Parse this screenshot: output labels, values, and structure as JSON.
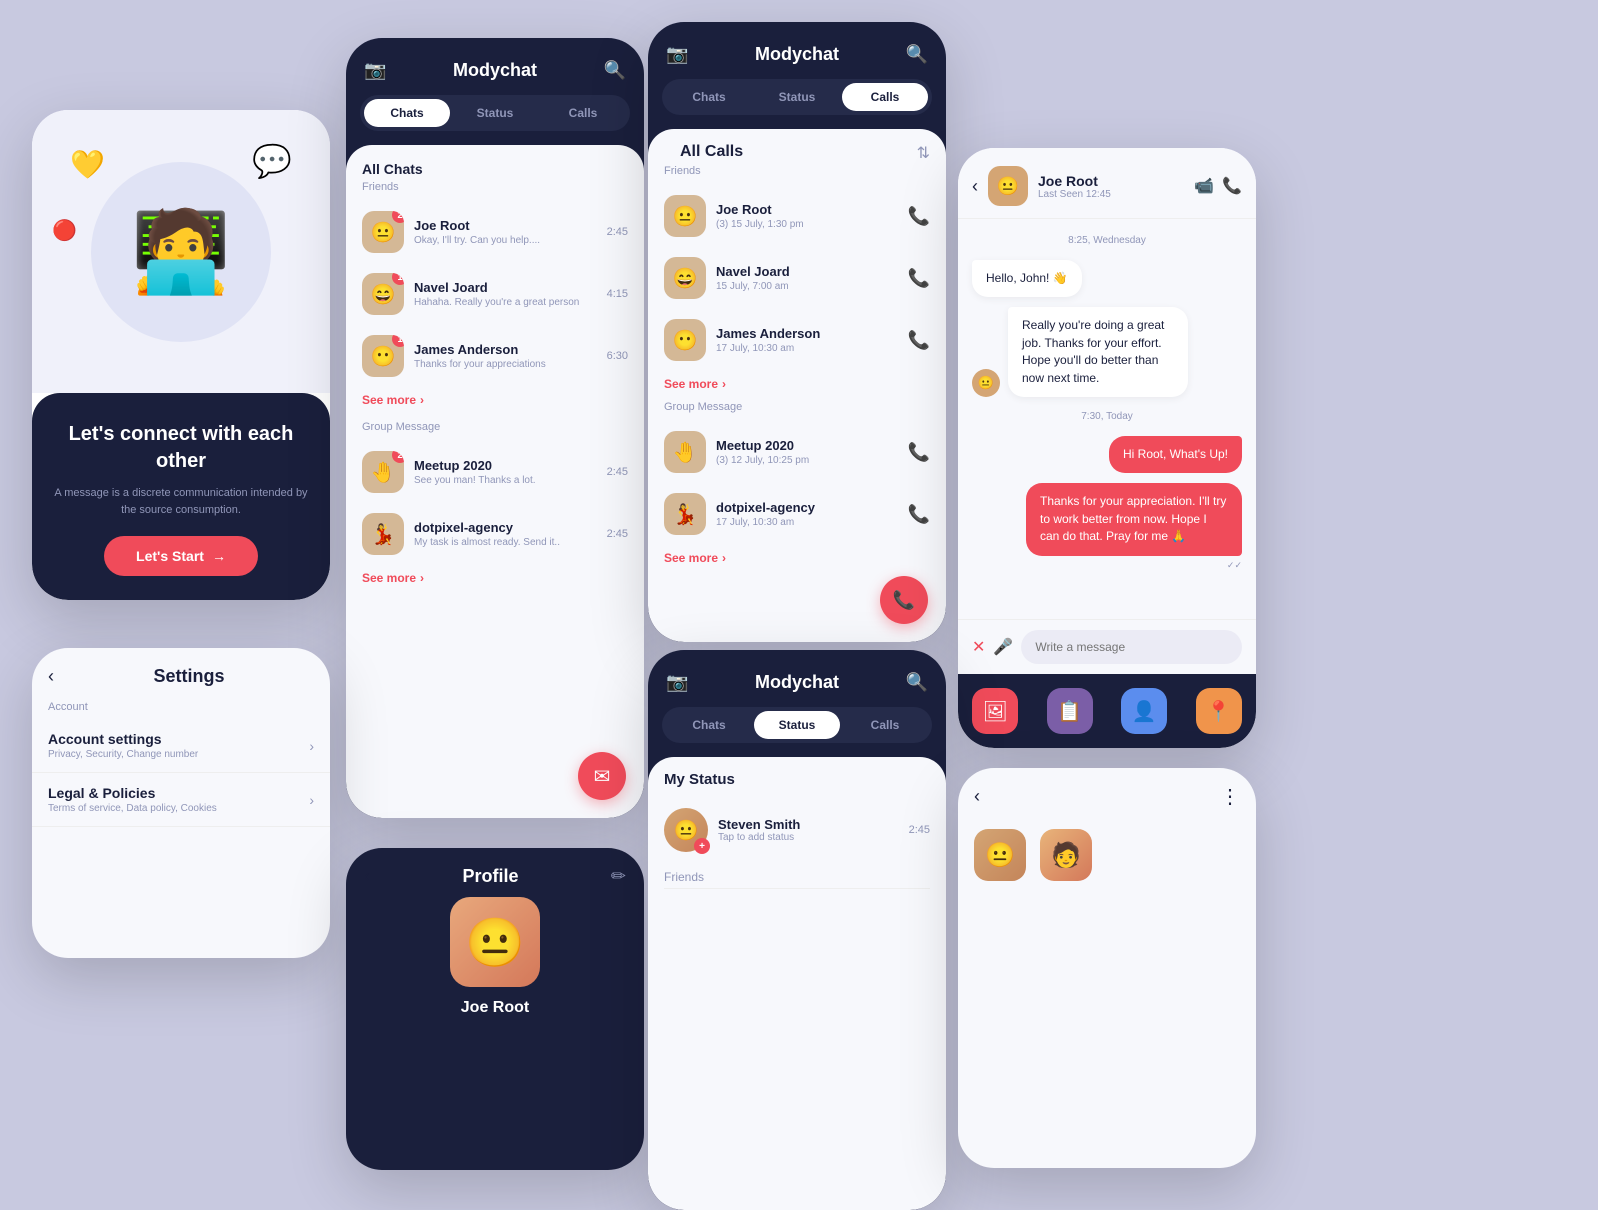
{
  "app": {
    "name": "Modychat"
  },
  "welcome": {
    "title": "Let's connect\nwith each other",
    "subtitle": "A message is a discrete communication intended by the source consumption.",
    "cta_label": "Let's Start",
    "cta_arrow": "→"
  },
  "tabs": {
    "chats": "Chats",
    "status": "Status",
    "calls": "Calls"
  },
  "chats_screen": {
    "section_friends": "All Chats",
    "sub_friends": "Friends",
    "sub_group": "Group Message",
    "see_more": "See more",
    "friends": [
      {
        "name": "Joe Root",
        "preview": "Okay, I'll try. Can you help....",
        "time": "2:45",
        "badge": "2",
        "face": "😐"
      },
      {
        "name": "Navel Joard",
        "preview": "Hahaha. Really you're a great person",
        "time": "4:15",
        "badge": "1",
        "face": "😄"
      },
      {
        "name": "James Anderson",
        "preview": "Thanks for your appreciations",
        "time": "6:30",
        "badge": "1",
        "face": "😶"
      }
    ],
    "groups": [
      {
        "name": "Meetup 2020",
        "preview": "See you man! Thanks a lot.",
        "time": "2:45",
        "badge": "2",
        "face": "🤚"
      },
      {
        "name": "dotpixel-agency",
        "preview": "My task is almost ready. Send it..",
        "time": "2:45",
        "face": "💃"
      }
    ]
  },
  "calls_screen": {
    "section_title": "All Calls",
    "sub_friends": "Friends",
    "sub_group": "Group Message",
    "see_more": "See more",
    "friends": [
      {
        "name": "Joe Root",
        "time": "(3) 15 July, 1:30 pm",
        "type": "incoming",
        "face": "😐"
      },
      {
        "name": "Navel Joard",
        "time": "15 July, 7:00 am",
        "type": "incoming",
        "face": "😄"
      },
      {
        "name": "James Anderson",
        "time": "17 July, 10:30 am",
        "type": "missed",
        "face": "😶"
      }
    ],
    "groups": [
      {
        "name": "Meetup 2020",
        "time": "(3) 12 July, 10:25 pm",
        "type": "incoming",
        "face": "🤚"
      },
      {
        "name": "dotpixel-agency",
        "time": "17 July, 10:30 am",
        "type": "missed",
        "face": "💃"
      }
    ]
  },
  "conversation": {
    "user_name": "Joe Root",
    "last_seen": "Last Seen 12:45",
    "date_divider": "8:25, Wednesday",
    "messages": [
      {
        "type": "received_plain",
        "text": "Hello, John! 👋",
        "sender": "other"
      },
      {
        "type": "received_avatar",
        "text": "Really you're doing a great job. Thanks for your effort. Hope you'll do better than now next time.",
        "sender": "other"
      },
      {
        "type": "date",
        "text": "7:30, Today"
      },
      {
        "type": "sent",
        "text": "Hi Root, What's Up!"
      },
      {
        "type": "sent_2",
        "text": "Thanks for your appreciation. I'll try to work better from now. Hope I can do that. Pray for me 🙏"
      },
      {
        "type": "read",
        "text": "✓✓"
      }
    ],
    "input_placeholder": "Write a message"
  },
  "settings": {
    "title": "Settings",
    "section_account": "Account",
    "items": [
      {
        "title": "Account settings",
        "sub": "Privacy, Security, Change number"
      },
      {
        "title": "Legal & Policies",
        "sub": "Terms of service, Data policy, Cookies"
      }
    ]
  },
  "profile": {
    "title": "Profile",
    "face": "😐"
  },
  "status_screen": {
    "section_my": "My Status",
    "section_friends": "Friends",
    "my_status": {
      "name": "Steven Smith",
      "time": "2:45",
      "tap": "Tap to add status",
      "face": "😐"
    }
  },
  "colors": {
    "primary_dark": "#1a1f3c",
    "accent_red": "#f04b5a",
    "bg_light": "#f7f8fc",
    "text_muted": "#9096b8",
    "incoming_call": "#1abc9c"
  }
}
